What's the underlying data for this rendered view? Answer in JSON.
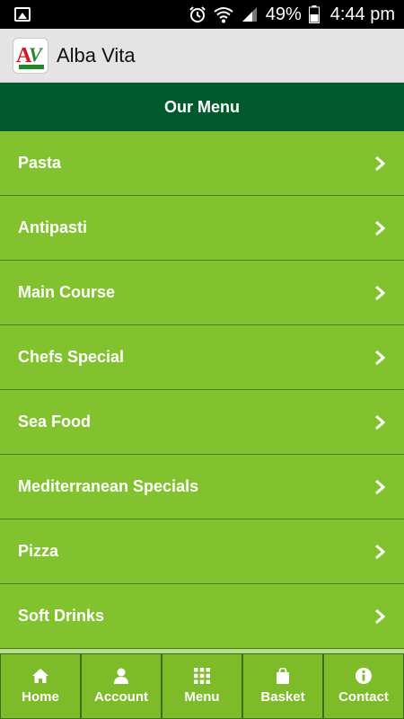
{
  "status_bar": {
    "battery_percent": "49%",
    "time": "4:44 pm"
  },
  "app_bar": {
    "title": "Alba Vita"
  },
  "header": {
    "title": "Our Menu"
  },
  "menu_items": [
    {
      "label": "Pasta"
    },
    {
      "label": "Antipasti"
    },
    {
      "label": "Main Course"
    },
    {
      "label": "Chefs Special"
    },
    {
      "label": "Sea Food"
    },
    {
      "label": "Mediterranean Specials"
    },
    {
      "label": "Pizza"
    },
    {
      "label": "Soft Drinks"
    }
  ],
  "bottom_nav": [
    {
      "label": "Home",
      "icon": "home-icon"
    },
    {
      "label": "Account",
      "icon": "user-icon"
    },
    {
      "label": "Menu",
      "icon": "grid-icon"
    },
    {
      "label": "Basket",
      "icon": "bag-icon"
    },
    {
      "label": "Contact",
      "icon": "info-icon"
    }
  ],
  "colors": {
    "header_bg": "#005a2e",
    "item_bg": "#83c22f",
    "nav_bg": "#7dbb29",
    "app_bar_bg": "#e4e4e4"
  }
}
